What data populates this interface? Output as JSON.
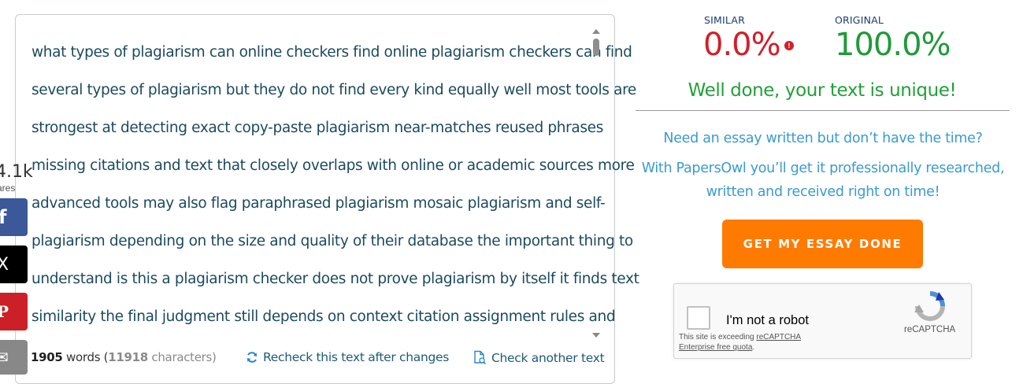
{
  "essay_text": {
    "lines": [
      "what types of plagiarism can online checkers find online plagiarism checkers can find",
      "several types of plagiarism but they do not find every kind equally well most tools are",
      "strongest at detecting exact copy-paste plagiarism near-matches reused phrases",
      "missing citations and text that closely overlaps with online or academic sources more",
      "advanced tools may also flag paraphrased plagiarism mosaic plagiarism and self-",
      "plagiarism depending on the size and quality of their database the important thing to",
      "understand is this a plagiarism checker does not prove plagiarism by itself it finds text",
      "similarity the final judgment still depends on context citation assignment rules and"
    ]
  },
  "footer": {
    "word_count": "1905",
    "words_label": " words (",
    "char_count": "11918",
    "chars_label": " characters)",
    "recheck_label": "Recheck this text after changes",
    "check_another_label": "Check another text"
  },
  "share": {
    "count": "4.1k",
    "label": "ares",
    "buttons": [
      {
        "name": "facebook",
        "glyph": "f"
      },
      {
        "name": "x",
        "glyph": "X"
      },
      {
        "name": "pinterest",
        "glyph": "P"
      },
      {
        "name": "email",
        "glyph": "✉"
      }
    ]
  },
  "results": {
    "similar_label": "SIMILAR",
    "similar_value": "0.0%",
    "info_glyph": "!",
    "original_label": "ORIGINAL",
    "original_value": "100.0%",
    "message": "Well done, your text is unique!"
  },
  "promo": {
    "line1": "Need an essay written but don’t have the time?",
    "line2": "With PapersOwl you’ll get it professionally researched,",
    "line3": "written and received right on time!",
    "cta_label": "GET MY ESSAY DONE"
  },
  "recaptcha": {
    "label": "I'm not a robot",
    "note_prefix": "This site is exceeding ",
    "note_link1": "reCAPTCHA",
    "note_link2": "Enterprise free quota",
    "note_suffix": ".",
    "brand": "reCAPTCHA"
  },
  "colors": {
    "similar": "#d0202a",
    "original": "#1f9a3a",
    "cta": "#ff7a00",
    "promo": "#3a9bd0"
  }
}
